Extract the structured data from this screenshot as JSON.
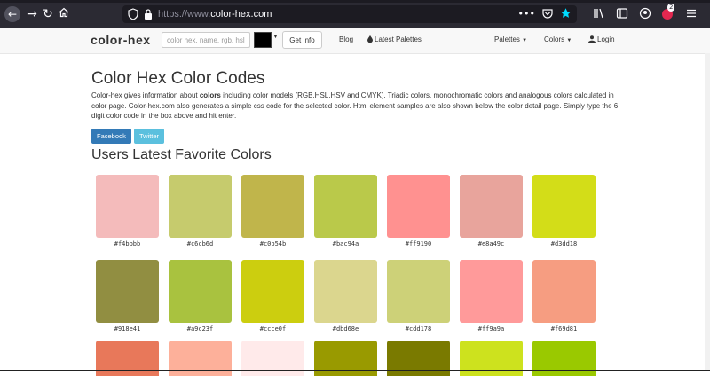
{
  "browser": {
    "url_scheme": "https://www.",
    "url_host": "color-hex.com",
    "menu_dots": "•••",
    "badge_count": "2"
  },
  "navbar": {
    "brand": "color-hex",
    "search_placeholder": "color hex, name, rgb, hsl",
    "get_info_label": "Get Info",
    "blog_label": "Blog",
    "latest_palettes_label": "Latest Palettes",
    "palettes_label": "Palettes",
    "colors_label": "Colors",
    "login_label": "Login",
    "picker_color": "#000000"
  },
  "main": {
    "title": "Color Hex Color Codes",
    "desc_part1": "Color-hex gives information about ",
    "desc_bold": "colors",
    "desc_part2": " including color models (RGB,HSL,HSV and CMYK), Triadic colors, monochromatic colors and analogous colors calculated in color page. Color-hex.com also generates a simple css code for the selected color. Html element samples are also shown below the color detail page. Simply type the 6 digit color code in the box above and hit enter.",
    "facebook_label": "Facebook",
    "twitter_label": "Twitter",
    "favorites_title": "Users Latest Favorite Colors"
  },
  "colors": [
    "#f4bbbb",
    "#c6cb6d",
    "#c0b54b",
    "#bac94a",
    "#ff9190",
    "#e8a49c",
    "#d3dd18",
    "#918e41",
    "#a9c23f",
    "#ccce0f",
    "#dbd68e",
    "#cdd178",
    "#ff9a9a",
    "#f69d81"
  ],
  "partial_row_colors": [
    "#e8785a",
    "#fdb09a",
    "#ffeaea",
    "#999a00",
    "#7a7a00",
    "#cde21e",
    "#9ac900"
  ]
}
